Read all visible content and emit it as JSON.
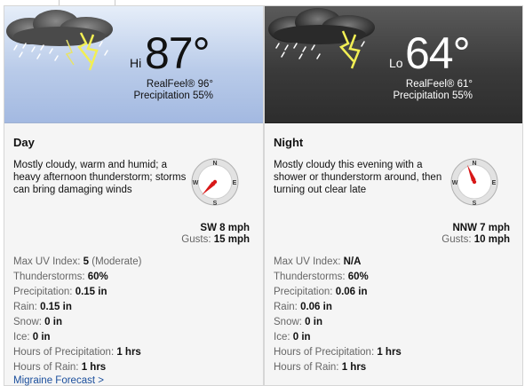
{
  "day": {
    "hilo_label": "Hi",
    "temperature": "87°",
    "realfeel": "RealFeel® 96°",
    "precipitation": "Precipitation 55%",
    "heading": "Day",
    "description": "Mostly cloudy, warm and humid; a heavy afternoon thunderstorm; storms can bring damaging winds",
    "compass": {
      "n": "N",
      "e": "E",
      "s": "S",
      "w": "W",
      "needle_direction": "SW",
      "needle_rotation_deg": 225
    },
    "wind": "SW 8 mph",
    "gusts_label": "Gusts:",
    "gusts_value": "15 mph",
    "stats": [
      {
        "label": "Max UV Index:",
        "value": "5",
        "note": "(Moderate)"
      },
      {
        "label": "Thunderstorms:",
        "value": "60%",
        "note": ""
      },
      {
        "label": "Precipitation:",
        "value": "0.15 in",
        "note": ""
      },
      {
        "label": "Rain:",
        "value": "0.15 in",
        "note": ""
      },
      {
        "label": "Snow:",
        "value": "0 in",
        "note": ""
      },
      {
        "label": "Ice:",
        "value": "0 in",
        "note": ""
      },
      {
        "label": "Hours of Precipitation:",
        "value": "1 hrs",
        "note": ""
      },
      {
        "label": "Hours of Rain:",
        "value": "1 hrs",
        "note": ""
      }
    ],
    "link": "Migraine Forecast >"
  },
  "night": {
    "hilo_label": "Lo",
    "temperature": "64°",
    "realfeel": "RealFeel® 61°",
    "precipitation": "Precipitation 55%",
    "heading": "Night",
    "description": "Mostly cloudy this evening with a shower or thunderstorm around, then turning out clear late",
    "compass": {
      "n": "N",
      "e": "E",
      "s": "S",
      "w": "W",
      "needle_direction": "NNW",
      "needle_rotation_deg": 337.5
    },
    "wind": "NNW 7 mph",
    "gusts_label": "Gusts:",
    "gusts_value": "10 mph",
    "stats": [
      {
        "label": "Max UV Index:",
        "value": "N/A",
        "note": ""
      },
      {
        "label": "Thunderstorms:",
        "value": "60%",
        "note": ""
      },
      {
        "label": "Precipitation:",
        "value": "0.06 in",
        "note": ""
      },
      {
        "label": "Rain:",
        "value": "0.06 in",
        "note": ""
      },
      {
        "label": "Snow:",
        "value": "0 in",
        "note": ""
      },
      {
        "label": "Ice:",
        "value": "0 in",
        "note": ""
      },
      {
        "label": "Hours of Precipitation:",
        "value": "1 hrs",
        "note": ""
      },
      {
        "label": "Hours of Rain:",
        "value": "1 hrs",
        "note": ""
      }
    ]
  },
  "icons": {
    "day_weather": "thunderstorm-cloud-icon",
    "night_weather": "night-thunderstorm-cloud-icon",
    "compass": "wind-compass-icon"
  },
  "colors": {
    "day_banner": "#b9cbe9",
    "night_banner": "#3a3a3a",
    "needle": "#d81818",
    "link": "#1a4e9c",
    "lightning": "#f2ef54"
  }
}
